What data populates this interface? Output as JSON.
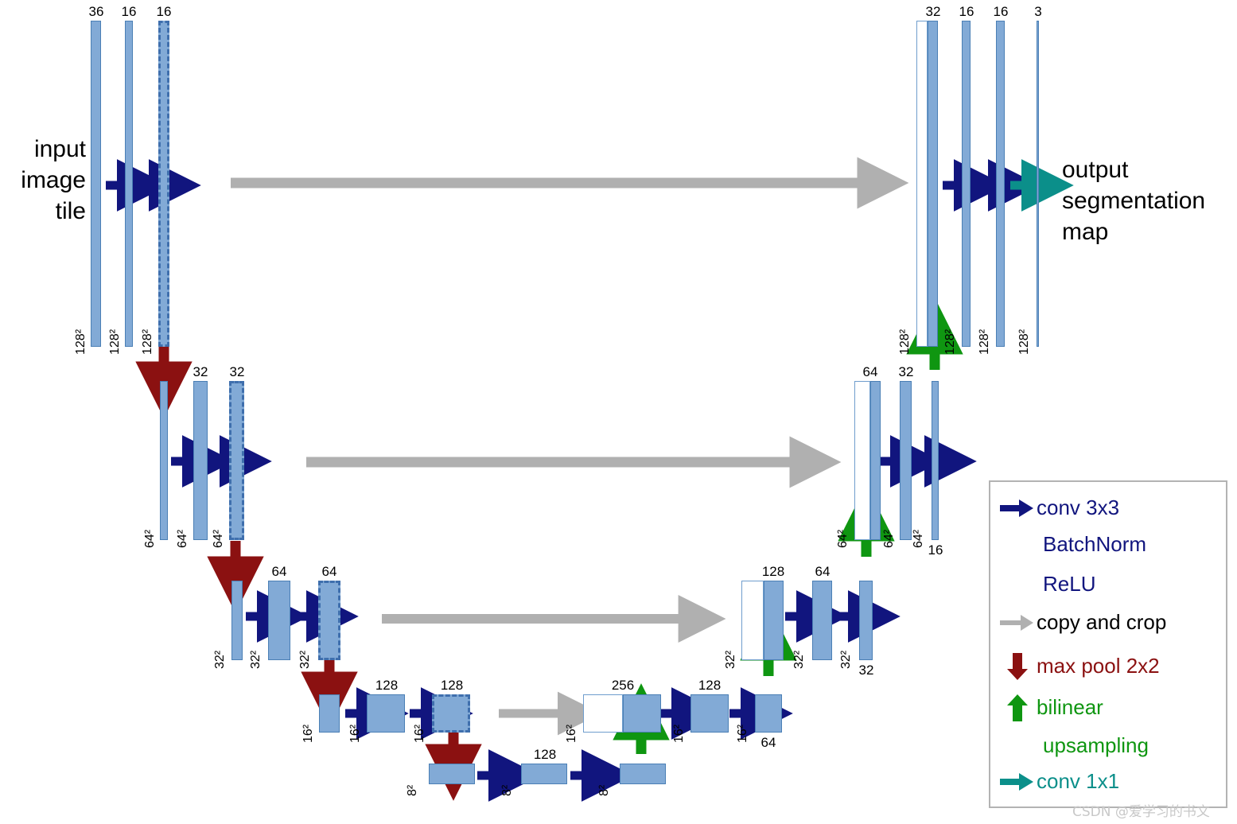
{
  "figure": {
    "type": "unet-architecture-diagram",
    "title_text_left": "input\nimage\ntile",
    "title_text_right": "output\nsegmentation\nmap"
  },
  "labels": {
    "input_tile": "input\nimage\ntile",
    "input_tile_l1": "input",
    "input_tile_l2": "image",
    "input_tile_l3": "tile",
    "output_map_l1": "output",
    "output_map_l2": "segmentation",
    "output_map_l3": "map"
  },
  "colors": {
    "block_fill": "#82aad6",
    "block_stroke": "#4a7fb5",
    "dashed_stroke": "#3f6fad",
    "conv_arrow": "#11157e",
    "copy_arrow": "#b0b0b0",
    "maxpool_arrow": "#8b1111",
    "upsample_arrow": "#0f9611",
    "conv1x1_arrow": "#0b8f8a",
    "legend_border": "#b3b3b3",
    "watermark": "#c8c8c8"
  },
  "levels": [
    {
      "name": "level-128",
      "resolution": "128²",
      "encoder_channels": [
        "36",
        "16",
        "16"
      ],
      "decoder_channels": [
        "32",
        "16",
        "16",
        "3"
      ]
    },
    {
      "name": "level-64",
      "resolution": "64²",
      "encoder_channels": [
        "",
        "32",
        "32"
      ],
      "decoder_channels": [
        "64",
        "32",
        "16"
      ]
    },
    {
      "name": "level-32",
      "resolution": "32²",
      "encoder_channels": [
        "",
        "64",
        "64"
      ],
      "decoder_channels": [
        "128",
        "64",
        "32"
      ]
    },
    {
      "name": "level-16",
      "resolution": "16²",
      "encoder_channels": [
        "",
        "128",
        "128"
      ],
      "decoder_channels": [
        "256",
        "128",
        "64"
      ]
    },
    {
      "name": "level-8",
      "resolution": "8²",
      "encoder_channels": [
        "",
        "128",
        ""
      ],
      "decoder_channels": []
    }
  ],
  "blocks": {
    "enc128_a_top": "36",
    "enc128_b_top": "16",
    "enc128_c_top": "16",
    "enc128_a_side": "128²",
    "enc128_b_side": "128²",
    "enc128_c_side": "128²",
    "dec128_a_top": "32",
    "dec128_b_top": "16",
    "dec128_c_top": "16",
    "dec128_d_top": "3",
    "dec128_a_side": "128²",
    "dec128_b_side": "128²",
    "dec128_c_side": "128²",
    "dec128_d_side": "128²",
    "enc64_b_top": "32",
    "enc64_c_top": "32",
    "enc64_a_side": "64²",
    "enc64_b_side": "64²",
    "enc64_c_side": "64²",
    "dec64_a_top": "64",
    "dec64_b_top": "32",
    "dec64_c_bot": "16",
    "dec64_a_side": "64²",
    "dec64_b_side": "64²",
    "dec64_c_side": "64²",
    "enc32_b_top": "64",
    "enc32_c_top": "64",
    "enc32_a_side": "32²",
    "enc32_b_side": "32²",
    "enc32_c_side": "32²",
    "dec32_a_top": "128",
    "dec32_b_top": "64",
    "dec32_c_bot": "32",
    "dec32_a_side": "32²",
    "dec32_b_side": "32²",
    "dec32_c_side": "32²",
    "enc16_b_top": "128",
    "enc16_c_top": "128",
    "enc16_a_side": "16²",
    "enc16_b_side": "16²",
    "enc16_c_side": "16²",
    "dec16_a_top": "256",
    "dec16_b_top": "128",
    "dec16_c_bot": "64",
    "dec16_a_side": "16²",
    "dec16_b_side": "16²",
    "dec16_c_side": "16²",
    "bot8_b_top": "128",
    "bot8_a_side": "8²",
    "bot8_b_side": "8²",
    "bot8_c_side": "8²"
  },
  "legend": {
    "items": [
      {
        "icon": "conv-arrow-icon",
        "color": "#11157e",
        "lines": [
          "conv 3x3",
          "BatchNorm",
          "ReLU"
        ]
      },
      {
        "icon": "copy-crop-arrow-icon",
        "color": "#000000",
        "lines": [
          "copy and crop"
        ]
      },
      {
        "icon": "maxpool-arrow-icon",
        "color": "#8b1111",
        "lines": [
          "max pool 2x2"
        ]
      },
      {
        "icon": "upsample-arrow-icon",
        "color": "#0f9611",
        "lines": [
          "bilinear",
          "upsampling"
        ]
      },
      {
        "icon": "conv1x1-arrow-icon",
        "color": "#0b8f8a",
        "lines": [
          "conv 1x1"
        ]
      }
    ],
    "l1_line1": "conv 3x3",
    "l1_line2": "BatchNorm",
    "l1_line3": "ReLU",
    "l2_line1": "copy and crop",
    "l3_line1": "max pool 2x2",
    "l4_line1": "bilinear",
    "l4_line2": "upsampling",
    "l5_line1": "conv 1x1"
  },
  "watermark": "CSDN @爱学习的书文"
}
